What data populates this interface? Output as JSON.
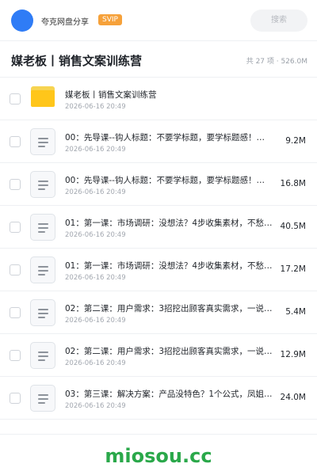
{
  "header": {
    "app_name": "夸克网盘分享",
    "badge": "SVIP",
    "search_placeholder": "搜索",
    "avatar_color": "#2f7cf6"
  },
  "folder": {
    "title": "媒老板丨销售文案训练营",
    "meta": "共 27 项 · 526.0M"
  },
  "files": [
    {
      "type": "folder",
      "icon": "folder-icon",
      "name": "媒老板丨销售文案训练营",
      "date": "2026-06-16 20:49",
      "size": ""
    },
    {
      "type": "doc",
      "icon": "document-icon",
      "name": "00：先导课--钩人标题：不要学标题，要学标题感！…",
      "date": "2026-06-16 20:49",
      "size": "9.2M"
    },
    {
      "type": "doc",
      "icon": "document-icon",
      "name": "00：先导课--钩人标题：不要学标题，要学标题感！…",
      "date": "2026-06-16 20:49",
      "size": "16.8M"
    },
    {
      "type": "doc",
      "icon": "document-icon",
      "name": "01：第一课：市场调研：没想法？4步收集素材，不愁…",
      "date": "2026-06-16 20:49",
      "size": "40.5M"
    },
    {
      "type": "doc",
      "icon": "document-icon",
      "name": "01：第一课：市场调研：没想法？4步收集素材，不愁…",
      "date": "2026-06-16 20:49",
      "size": "17.2M"
    },
    {
      "type": "doc",
      "icon": "document-icon",
      "name": "02：第二课：用户需求：3招挖出顾客真实需求，一说…",
      "date": "2026-06-16 20:49",
      "size": "5.4M"
    },
    {
      "type": "doc",
      "icon": "document-icon",
      "name": "02：第二课：用户需求：3招挖出顾客真实需求，一说…",
      "date": "2026-06-16 20:49",
      "size": "12.9M"
    },
    {
      "type": "doc",
      "icon": "document-icon",
      "name": "03：第三课：解决方案：产品没特色？1个公式，凤姐…",
      "date": "2026-06-16 20:49",
      "size": "24.0M"
    }
  ],
  "watermark": "miosou.cc",
  "colors": {
    "accent": "#2f7cf6",
    "svip": "#f6a13a",
    "folder": "#ffc61a",
    "watermark": "#2aa84a"
  }
}
